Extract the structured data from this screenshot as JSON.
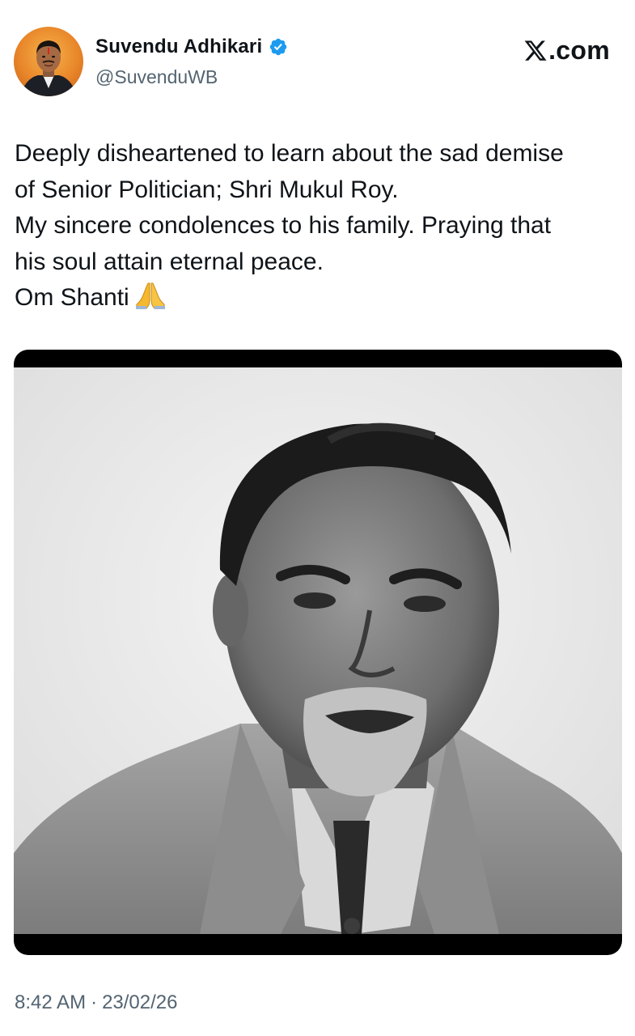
{
  "author": {
    "name": "Suvendu Adhikari",
    "handle": "@SuvenduWB",
    "verified": true,
    "badge_color": "#1d9bf0"
  },
  "site": {
    "logo_text": ".com",
    "logo_icon": "x-logo-icon"
  },
  "tweet": {
    "lines": [
      "Deeply disheartened to learn about the sad demise",
      "of Senior Politician; Shri Mukul Roy.",
      "My sincere condolences to his family. Praying that",
      "his soul attain eternal peace.",
      "Om Shanti"
    ],
    "emoji": "folded-hands-icon"
  },
  "media": {
    "type": "photo",
    "style": "black-and-white portrait"
  },
  "meta": {
    "time": "8:42 AM",
    "separator": "·",
    "date": "23/02/26"
  },
  "colors": {
    "text": "#0f1419",
    "secondary": "#536471",
    "verified": "#1d9bf0"
  }
}
